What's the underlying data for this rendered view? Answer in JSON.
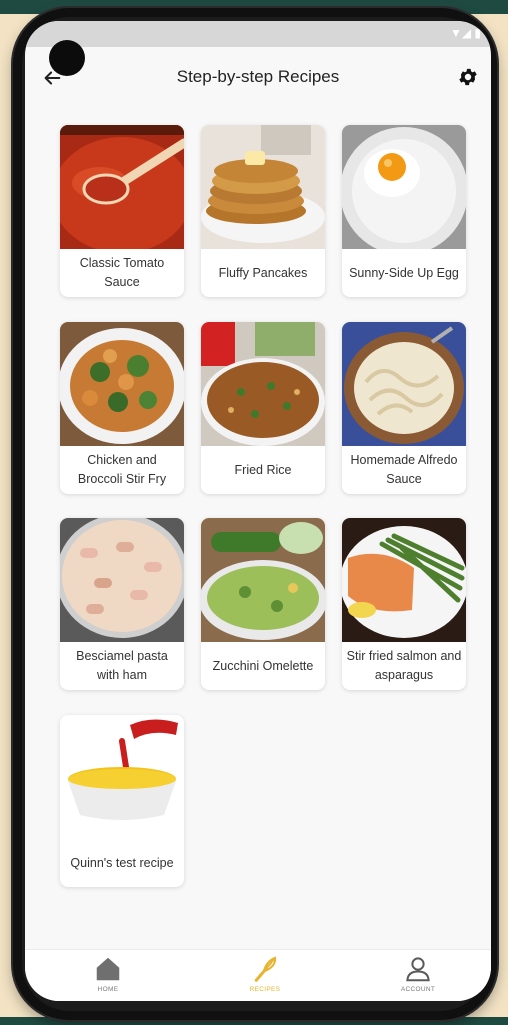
{
  "header": {
    "title": "Step-by-step Recipes"
  },
  "recipes": [
    {
      "title": "Classic Tomato Sauce"
    },
    {
      "title": "Fluffy Pancakes"
    },
    {
      "title": "Sunny-Side Up Egg"
    },
    {
      "title": "Chicken and Broccoli Stir Fry"
    },
    {
      "title": "Fried Rice"
    },
    {
      "title": "Homemade Alfredo Sauce"
    },
    {
      "title": "Besciamel pasta with ham"
    },
    {
      "title": "Zucchini Omelette"
    },
    {
      "title": "Stir fried salmon and asparagus"
    },
    {
      "title": "Quinn's test recipe"
    }
  ],
  "nav": {
    "home": "HOME",
    "recipes": "RECIPES",
    "account": "ACCOUNT",
    "active_color": "#e8b430",
    "inactive_color": "#7a7a7a"
  },
  "colors": {
    "accent": "#e8b430",
    "frame": "#101010",
    "background": "#f3e3c4"
  }
}
